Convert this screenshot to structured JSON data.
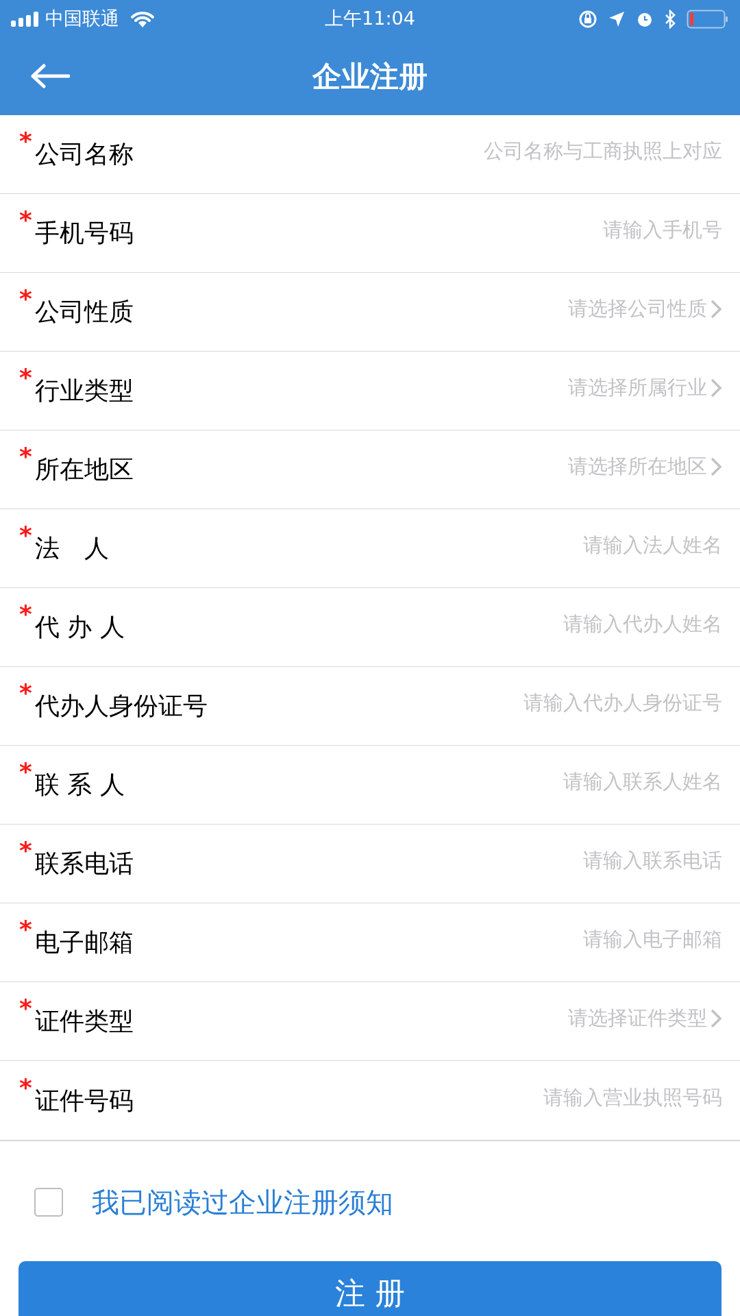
{
  "status_bar": {
    "carrier": "中国联通",
    "time": "上午11:04"
  },
  "nav": {
    "title": "企业注册"
  },
  "fields": [
    {
      "marker": "*",
      "label": "公司名称",
      "kind": "input",
      "placeholder": "公司名称与工商执照上对应"
    },
    {
      "marker": "*",
      "label": "手机号码",
      "kind": "input",
      "placeholder": "请输入手机号"
    },
    {
      "marker": "*",
      "label": "公司性质",
      "kind": "select",
      "placeholder": "请选择公司性质"
    },
    {
      "marker": "*",
      "label": "行业类型",
      "kind": "select",
      "placeholder": "请选择所属行业"
    },
    {
      "marker": "*",
      "label": "所在地区",
      "kind": "select",
      "placeholder": "请选择所在地区"
    },
    {
      "marker": "*",
      "label": "法　人",
      "kind": "input",
      "placeholder": "请输入法人姓名"
    },
    {
      "marker": "*",
      "label": "代 办 人",
      "kind": "input",
      "placeholder": "请输入代办人姓名"
    },
    {
      "marker": "*",
      "label": "代办人身份证号",
      "kind": "input",
      "placeholder": "请输入代办人身份证号"
    },
    {
      "marker": "*",
      "label": "联 系 人",
      "kind": "input",
      "placeholder": "请输入联系人姓名"
    },
    {
      "marker": "*",
      "label": "联系电话",
      "kind": "input",
      "placeholder": "请输入联系电话"
    },
    {
      "marker": "*",
      "label": "电子邮箱",
      "kind": "input",
      "placeholder": "请输入电子邮箱"
    },
    {
      "marker": "*",
      "label": "证件类型",
      "kind": "select",
      "placeholder": "请选择证件类型"
    },
    {
      "marker": "*",
      "label": "证件号码",
      "kind": "input",
      "placeholder": "请输入营业执照号码"
    }
  ],
  "agreement": {
    "checked": false,
    "text": "我已阅读过企业注册须知"
  },
  "submit": {
    "label": "注 册"
  }
}
